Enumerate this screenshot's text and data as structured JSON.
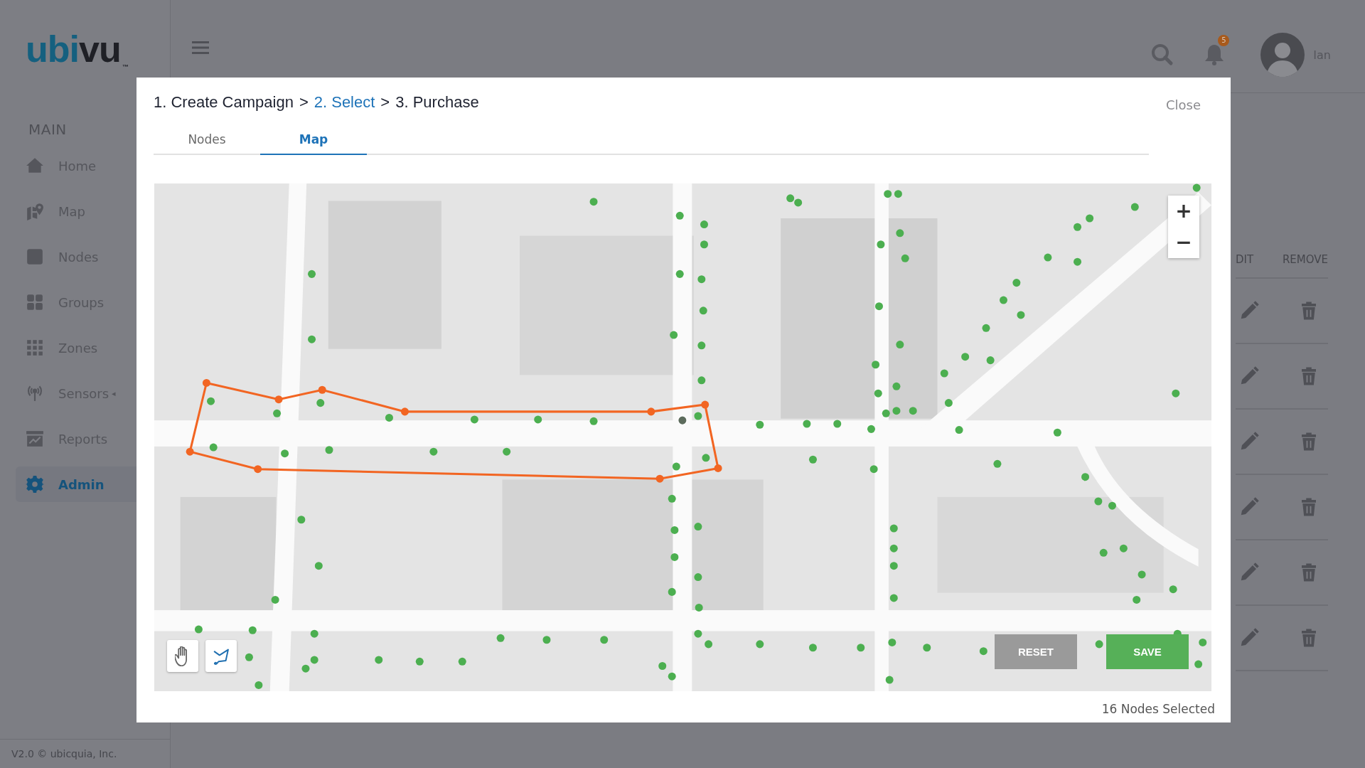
{
  "sidebar": {
    "logo": {
      "parts": [
        {
          "text": "ubi",
          "kind": "accent"
        },
        {
          "text": "vu",
          "kind": "dark"
        }
      ],
      "mark": "™"
    },
    "section": "MAIN",
    "items": [
      {
        "label": "Home",
        "selected": false
      },
      {
        "label": "Map",
        "selected": false
      },
      {
        "label": "Nodes",
        "selected": false
      },
      {
        "label": "Groups",
        "selected": false
      },
      {
        "label": "Zones",
        "selected": false
      },
      {
        "label": "Sensors",
        "selected": false,
        "caret": "◂"
      },
      {
        "label": "Reports",
        "selected": false
      },
      {
        "label": "Admin",
        "selected": true
      }
    ],
    "footer": "V2.0 © ubicquia, Inc."
  },
  "header": {
    "notifications": "5",
    "user": "Ian"
  },
  "table": {
    "columns": [
      "DIT",
      "REMOVE"
    ]
  },
  "modal": {
    "steps": [
      {
        "label": "1. Create Campaign",
        "selected": false
      },
      {
        "separator": ">",
        "label": "2. Select",
        "selected": true
      },
      {
        "separator": ">",
        "label": "3. Purchase",
        "selected": false
      }
    ],
    "close": "Close",
    "tabs": [
      {
        "label": "Nodes",
        "selected": false
      },
      {
        "label": "Map",
        "selected": true
      }
    ],
    "map": {
      "kind": "picture",
      "zoom_in": "+",
      "zoom_out": "−"
    },
    "buttons": [
      {
        "label": "RESET",
        "kind": "secondary"
      },
      {
        "label": "SAVE",
        "kind": "primary"
      }
    ],
    "status": "16 Nodes Selected"
  }
}
